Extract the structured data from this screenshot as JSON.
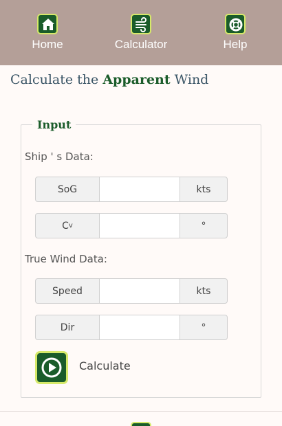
{
  "nav": {
    "home": {
      "label": "Home",
      "icon": "home-icon"
    },
    "calculator": {
      "label": "Calculator",
      "icon": "wind-icon"
    },
    "help": {
      "label": "Help",
      "icon": "lifebuoy-icon"
    }
  },
  "title": {
    "prefix": "Calculate the",
    "emphasis": "Apparent",
    "suffix": "Wind"
  },
  "input_section": {
    "legend": "Input",
    "ship_label": "Ship ' s Data:",
    "wind_label": "True Wind Data:",
    "fields": {
      "sog": {
        "prefix": "SoG",
        "unit": "kts",
        "value": ""
      },
      "cv": {
        "prefix_main": "C",
        "prefix_sub": "v",
        "unit": "°",
        "value": ""
      },
      "speed": {
        "prefix": "Speed",
        "unit": "kts",
        "value": ""
      },
      "dir": {
        "prefix": "Dir",
        "unit": "°",
        "value": ""
      }
    }
  },
  "calculate": {
    "label": "Calculate",
    "icon": "play-icon"
  },
  "colors": {
    "navbar": "#b49f98",
    "brand_green": "#1a5c2a",
    "accent_yellow": "#d6e96a",
    "title_text": "#3a5566"
  }
}
